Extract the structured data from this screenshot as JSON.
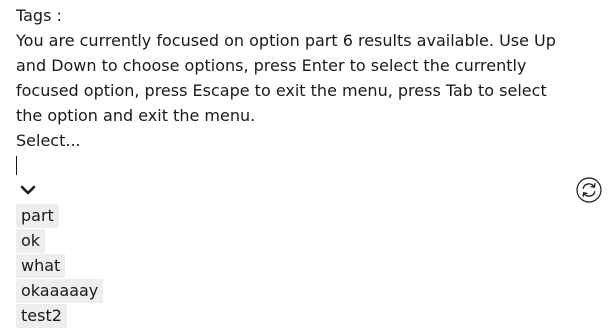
{
  "field": {
    "label": "Tags :",
    "live_region": "You are currently focused on option part 6 results available. Use Up and Down to choose options, press Enter to select the currently focused option, press Escape to exit the menu, press Tab to select the option and exit the menu.",
    "placeholder": "Select...",
    "input_value": ""
  },
  "icons": {
    "dropdown": "chevron-down-icon",
    "refresh": "refresh-icon"
  },
  "options": [
    {
      "label": "part"
    },
    {
      "label": "ok"
    },
    {
      "label": "what"
    },
    {
      "label": "okaaaaay"
    },
    {
      "label": "test2"
    }
  ],
  "colors": {
    "option_bg": "#eeeeee",
    "text": "#1a1a1a"
  }
}
